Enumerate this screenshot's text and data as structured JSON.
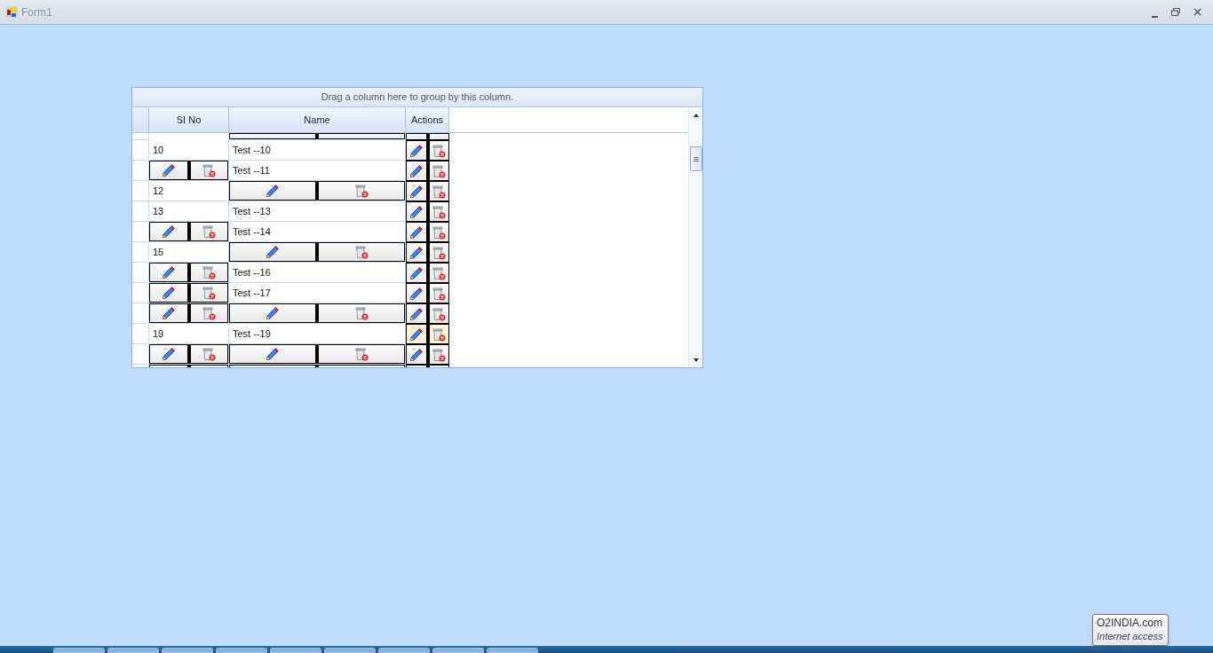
{
  "window": {
    "title": "Form1"
  },
  "grid": {
    "group_panel": "Drag a column here to group by this column.",
    "columns": [
      "SI No",
      "Name",
      "Actions"
    ],
    "rows": [
      {
        "partial": true,
        "hovered": false,
        "cells": [
          {
            "kind": "blank"
          },
          {
            "kind": "buttons"
          }
        ]
      },
      {
        "partial": false,
        "hovered": false,
        "cells": [
          {
            "kind": "text",
            "text": "10"
          },
          {
            "kind": "text",
            "text": "Test --10"
          }
        ]
      },
      {
        "partial": false,
        "hovered": false,
        "cells": [
          {
            "kind": "buttons"
          },
          {
            "kind": "text",
            "text": "Test --11"
          }
        ]
      },
      {
        "partial": false,
        "hovered": false,
        "cells": [
          {
            "kind": "text",
            "text": "12"
          },
          {
            "kind": "buttons"
          }
        ]
      },
      {
        "partial": false,
        "hovered": false,
        "cells": [
          {
            "kind": "text",
            "text": "13"
          },
          {
            "kind": "text",
            "text": "Test --13"
          }
        ]
      },
      {
        "partial": false,
        "hovered": false,
        "cells": [
          {
            "kind": "buttons"
          },
          {
            "kind": "text",
            "text": "Test --14"
          }
        ]
      },
      {
        "partial": false,
        "hovered": false,
        "cells": [
          {
            "kind": "text",
            "text": "15"
          },
          {
            "kind": "buttons"
          }
        ]
      },
      {
        "partial": false,
        "hovered": false,
        "cells": [
          {
            "kind": "buttons"
          },
          {
            "kind": "text",
            "text": "Test --16"
          }
        ]
      },
      {
        "partial": false,
        "hovered": false,
        "cells": [
          {
            "kind": "buttons"
          },
          {
            "kind": "text",
            "text": "Test --17"
          }
        ]
      },
      {
        "partial": false,
        "hovered": false,
        "cells": [
          {
            "kind": "buttons"
          },
          {
            "kind": "buttons"
          }
        ]
      },
      {
        "partial": false,
        "hovered": true,
        "cells": [
          {
            "kind": "text",
            "text": "19"
          },
          {
            "kind": "text",
            "text": "Test --19"
          }
        ]
      },
      {
        "partial": false,
        "hovered": false,
        "cells": [
          {
            "kind": "buttons"
          },
          {
            "kind": "buttons"
          }
        ]
      },
      {
        "partial": true,
        "hovered": false,
        "cells": [
          {
            "kind": "buttons"
          },
          {
            "kind": "buttons"
          }
        ]
      }
    ]
  },
  "tooltip": {
    "title": "O2INDIA.com",
    "subtitle": "Internet access"
  }
}
